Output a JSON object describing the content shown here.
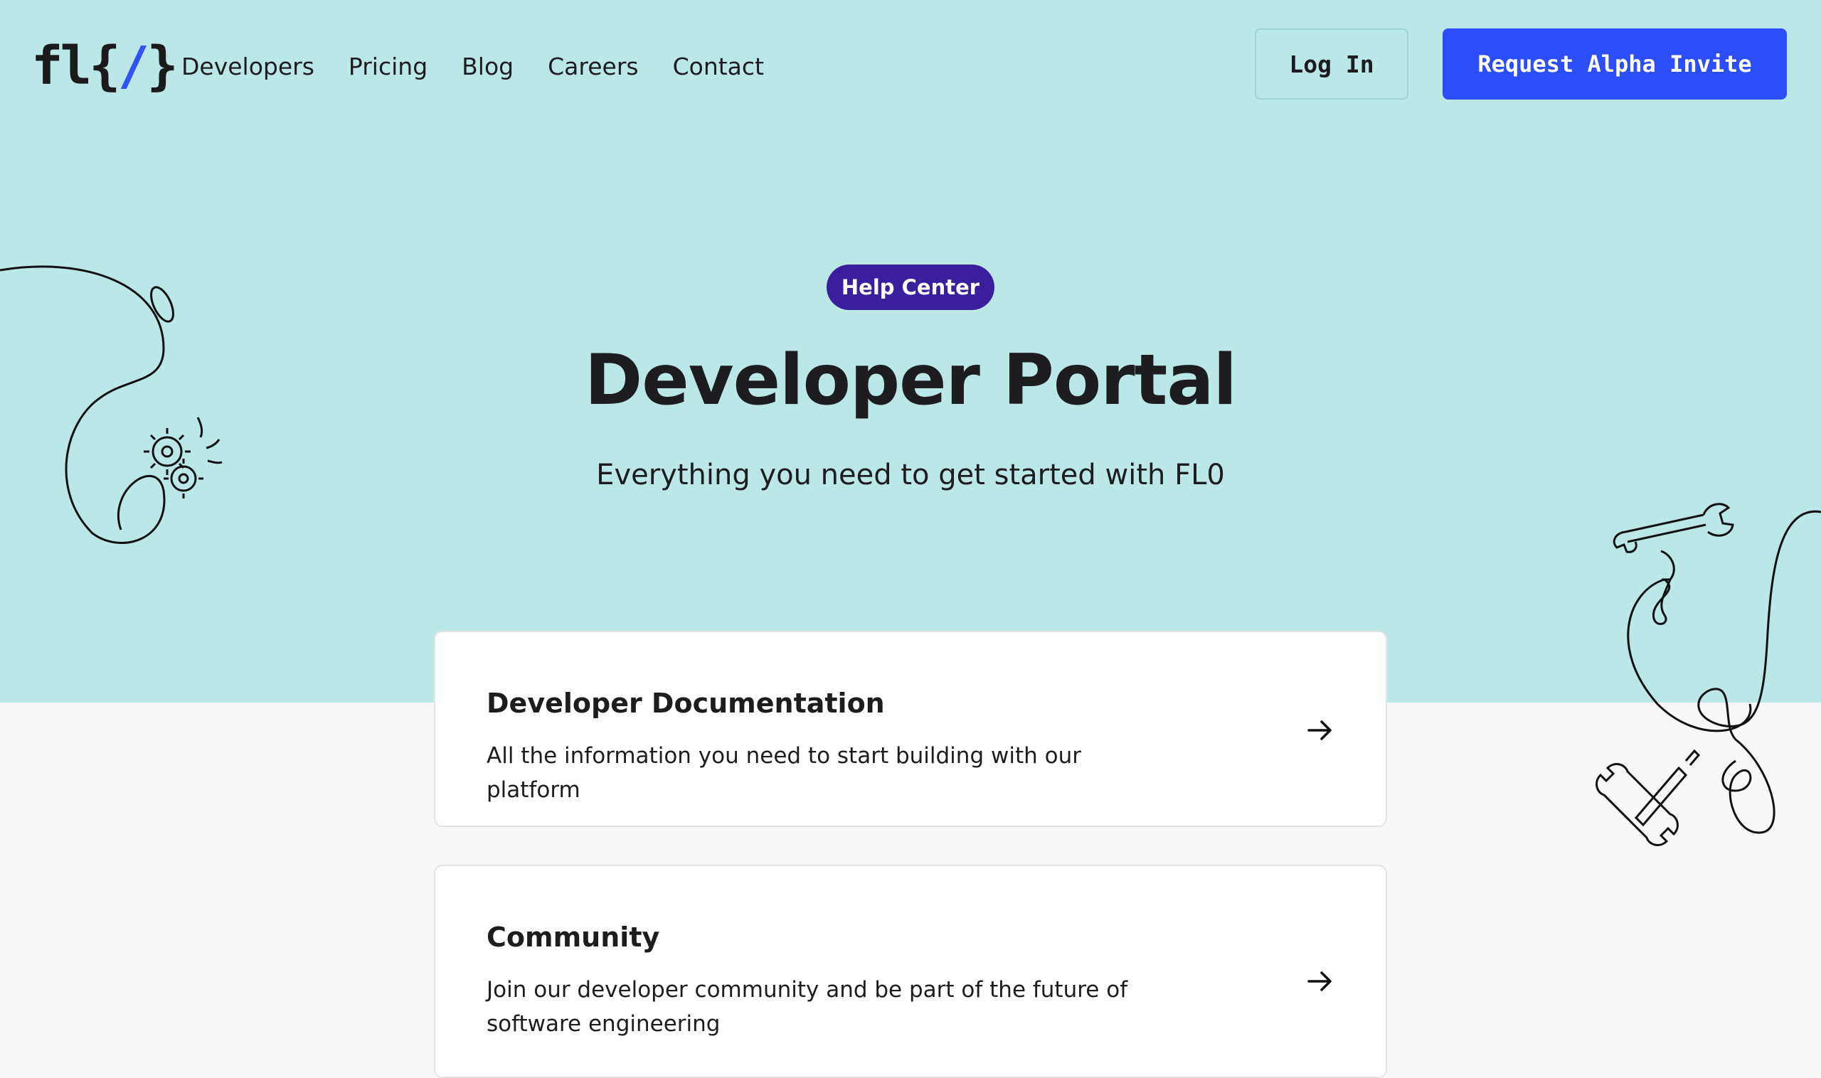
{
  "header": {
    "logo": {
      "part1": "fl{",
      "slash": "/",
      "part2": "}"
    },
    "nav": [
      "Developers",
      "Pricing",
      "Blog",
      "Careers",
      "Contact"
    ],
    "login_label": "Log In",
    "request_label": "Request Alpha Invite"
  },
  "hero": {
    "badge": "Help Center",
    "title": "Developer Portal",
    "subtitle": "Everything you need to get started with FL0"
  },
  "cards": [
    {
      "title": "Developer Documentation",
      "description": "All the information you need to start building with our platform"
    },
    {
      "title": "Community",
      "description": "Join our developer community and be part of the future of software engineering"
    }
  ],
  "colors": {
    "hero_bg": "#bbe7e7",
    "accent_blue": "#2c4ef8",
    "badge_purple": "#3a1f9d",
    "page_bg": "#f7f7f7"
  }
}
